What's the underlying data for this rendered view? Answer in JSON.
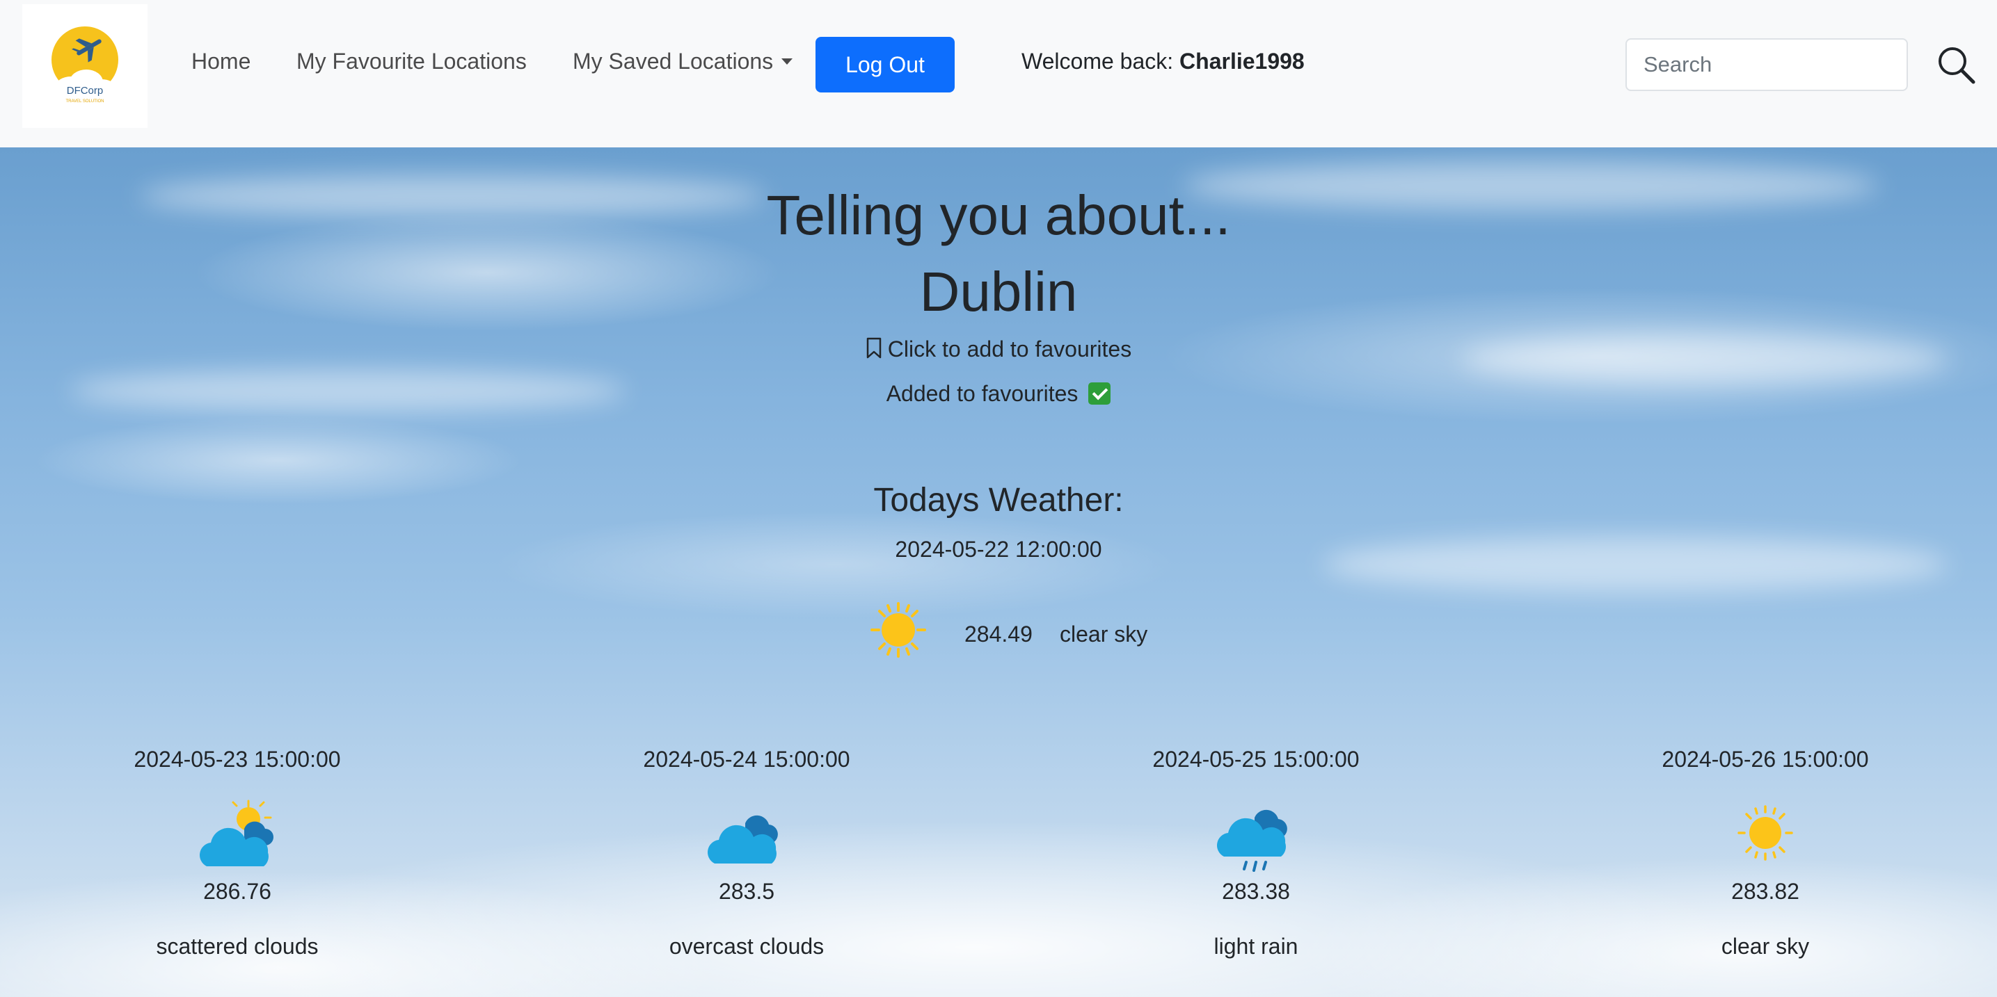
{
  "navbar": {
    "logo_text": "DFCorp",
    "logo_tagline": "TRAVEL SOLUTION",
    "links": {
      "home": "Home",
      "favourites": "My Favourite Locations",
      "saved": "My Saved Locations"
    },
    "logout_label": "Log Out",
    "welcome_prefix": "Welcome back: ",
    "username": "Charlie1998",
    "search_placeholder": "Search"
  },
  "hero": {
    "title": "Telling you about...",
    "city": "Dublin",
    "add_favourite_label": "Click to add to favourites",
    "favourite_status": "Added to favourites"
  },
  "today": {
    "heading": "Todays Weather:",
    "datetime": "2024-05-22 12:00:00",
    "icon": "sun-icon",
    "temperature": "284.49",
    "description": "clear sky"
  },
  "forecast": [
    {
      "datetime": "2024-05-23 15:00:00",
      "icon": "partly-cloudy-icon",
      "temperature": "286.76",
      "description": "scattered clouds"
    },
    {
      "datetime": "2024-05-24 15:00:00",
      "icon": "cloud-icon",
      "temperature": "283.5",
      "description": "overcast clouds"
    },
    {
      "datetime": "2024-05-25 15:00:00",
      "icon": "rain-cloud-icon",
      "temperature": "283.38",
      "description": "light rain"
    },
    {
      "datetime": "2024-05-26 15:00:00",
      "icon": "sun-icon",
      "temperature": "283.82",
      "description": "clear sky"
    }
  ],
  "colors": {
    "primary_button": "#0d6efd",
    "navbar_bg": "#f8f9fa",
    "sun": "#fcc419",
    "cloud": "#1fa6e0",
    "cloud_dark": "#1b75b3"
  }
}
